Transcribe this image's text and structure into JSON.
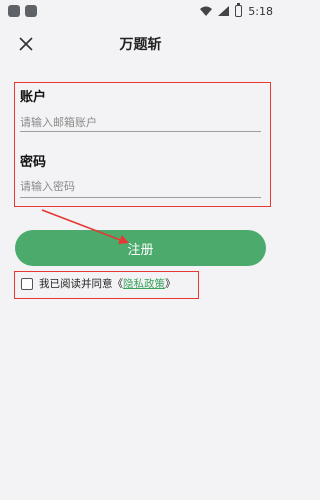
{
  "status_bar": {
    "time": "5:18"
  },
  "header": {
    "title": "万题斩"
  },
  "form": {
    "account_label": "账户",
    "account_placeholder": "请输入邮箱账户",
    "password_label": "密码",
    "password_placeholder": "请输入密码"
  },
  "register_button": {
    "label": "注册",
    "color": "#4caa6c"
  },
  "agreement": {
    "text": "我已阅读并同意",
    "open_bracket": "《",
    "link": "隐私政策",
    "close_bracket": "》"
  },
  "colors": {
    "highlight": "#e53935",
    "link": "#3aa35c",
    "background": "#f3f3f5"
  }
}
